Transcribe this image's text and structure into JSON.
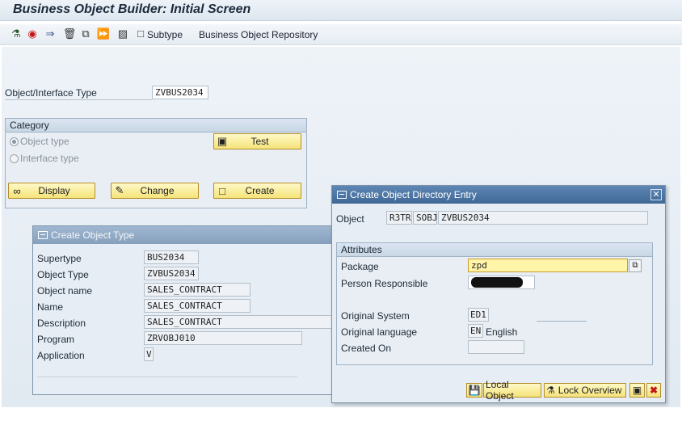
{
  "window": {
    "title": "Business Object Builder: Initial Screen"
  },
  "toolbar": {
    "icons": [
      "hierarchy-icon",
      "stop-icon",
      "flow-icon",
      "delete-icon",
      "copy-icon",
      "forward-icon",
      "tree-icon"
    ],
    "subtype_label": "Subtype",
    "repository_label": "Business Object Repository"
  },
  "main": {
    "object_type_label": "Object/Interface Type",
    "object_type_value": "ZVBUS2034",
    "category": {
      "title": "Category",
      "radio_object": "Object type",
      "radio_interface": "Interface type",
      "test_label": "Test",
      "display_label": "Display",
      "change_label": "Change",
      "create_label": "Create"
    }
  },
  "create_object_type": {
    "title": "Create Object Type",
    "supertype_label": "Supertype",
    "supertype_value": "BUS2034",
    "object_type_label": "Object Type",
    "object_type_value": "ZVBUS2034",
    "object_name_label": "Object name",
    "object_name_value": "SALES_CONTRACT",
    "name_label": "Name",
    "name_value": "SALES_CONTRACT",
    "description_label": "Description",
    "description_value": "SALES_CONTRACT",
    "program_label": "Program",
    "program_value": "ZRVOBJ010",
    "application_label": "Application",
    "application_value": "V"
  },
  "directory_entry": {
    "title": "Create Object Directory Entry",
    "object_label": "Object",
    "object_pgmid": "R3TR",
    "object_type": "SOBJ",
    "object_name": "ZVBUS2034",
    "attributes_title": "Attributes",
    "package_label": "Package",
    "package_value": "zpd",
    "person_label": "Person Responsible",
    "original_system_label": "Original System",
    "original_system_value": "ED1",
    "original_language_label": "Original language",
    "original_language_value": "EN",
    "original_language_text": "English",
    "created_on_label": "Created On",
    "created_on_value": "",
    "local_object_label": "Local Object",
    "lock_overview_label": "Lock Overview"
  },
  "colors": {
    "button_yellow": "#f5e37a",
    "dialog_blue": "#3f6897",
    "field_yellow": "#fff4a8"
  }
}
